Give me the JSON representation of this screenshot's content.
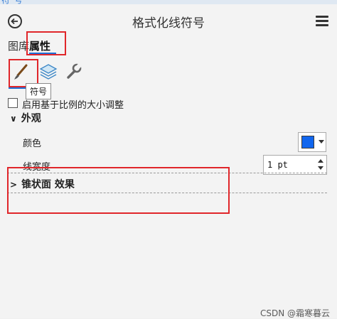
{
  "window": {
    "title": "格式化线符号"
  },
  "top_strip": {
    "text": "符 号"
  },
  "tabs": [
    {
      "label": "图库",
      "active": false
    },
    {
      "label": "属性",
      "active": true
    }
  ],
  "tools": [
    {
      "icon": "brush-icon",
      "tooltip": "符号",
      "selected": true
    },
    {
      "icon": "layers-icon"
    },
    {
      "icon": "wrench-icon"
    }
  ],
  "options": {
    "scale_checkbox_label": "启用基于比例的大小调整",
    "checked": false
  },
  "appearance": {
    "header": "外观",
    "color_label": "颜色",
    "color_value": "#1166ee",
    "width_label": "线宽度",
    "width_value": "1 pt"
  },
  "effects_section": {
    "header": "锥状面 效果"
  },
  "watermark": "CSDN @霜寒暮云",
  "colors": {
    "accent": "#1e6fd6",
    "highlight": "#e0262a"
  }
}
